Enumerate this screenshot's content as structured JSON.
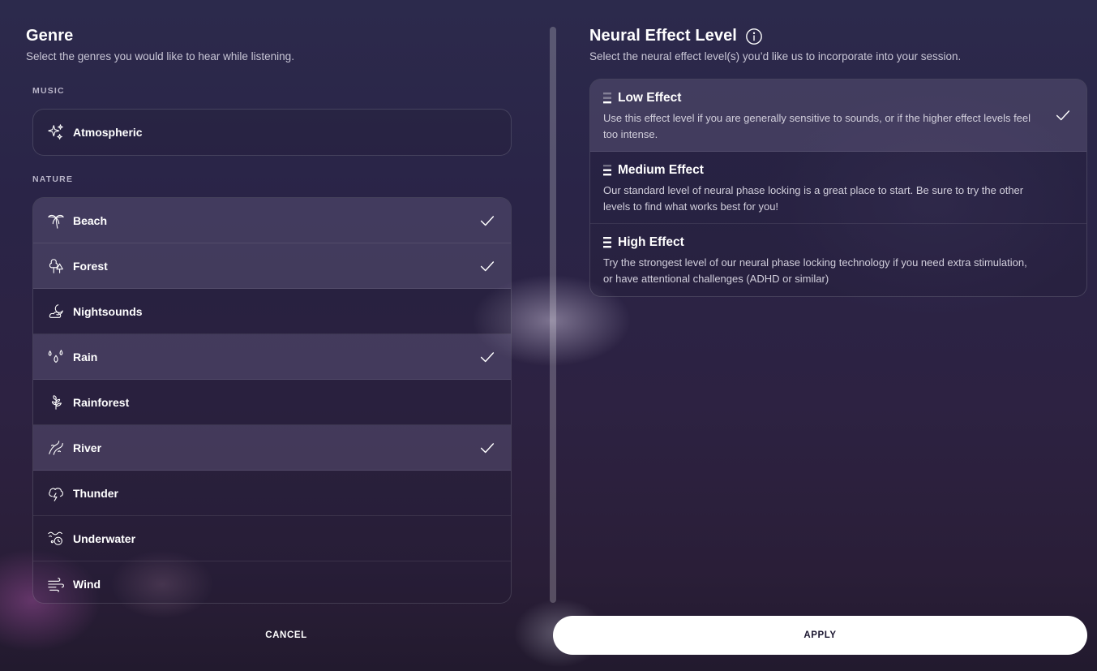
{
  "genre": {
    "title": "Genre",
    "subtitle": "Select the genres you would like to hear while listening.",
    "groups": [
      {
        "label": "MUSIC",
        "items": [
          {
            "label": "Atmospheric",
            "icon": "sparkles-icon",
            "selected": false
          }
        ]
      },
      {
        "label": "NATURE",
        "items": [
          {
            "label": "Beach",
            "icon": "palm-tree-icon",
            "selected": true
          },
          {
            "label": "Forest",
            "icon": "trees-icon",
            "selected": true
          },
          {
            "label": "Nightsounds",
            "icon": "moon-cloud-icon",
            "selected": false
          },
          {
            "label": "Rain",
            "icon": "raindrops-icon",
            "selected": true
          },
          {
            "label": "Rainforest",
            "icon": "sprout-icon",
            "selected": false
          },
          {
            "label": "River",
            "icon": "river-icon",
            "selected": true
          },
          {
            "label": "Thunder",
            "icon": "thunder-cloud-icon",
            "selected": false
          },
          {
            "label": "Underwater",
            "icon": "underwater-icon",
            "selected": false
          },
          {
            "label": "Wind",
            "icon": "wind-icon",
            "selected": false
          }
        ]
      }
    ]
  },
  "neural": {
    "title": "Neural Effect Level",
    "subtitle": "Select the neural effect level(s) you’d like us to incorporate into your session.",
    "levels": [
      {
        "label": "Low Effect",
        "description": "Use this effect level if you are generally sensitive to sounds, or if the higher effect levels feel too intense.",
        "bars_filled": 1,
        "selected": true
      },
      {
        "label": "Medium Effect",
        "description": "Our standard level of neural phase locking is a great place to start. Be sure to try the other levels to find what works best for you!",
        "bars_filled": 2,
        "selected": false
      },
      {
        "label": "High Effect",
        "description": "Try the strongest level of our neural phase locking technology if you need extra stimulation, or have attentional challenges (ADHD or similar)",
        "bars_filled": 3,
        "selected": false
      }
    ]
  },
  "footer": {
    "cancel_label": "CANCEL",
    "apply_label": "APPLY"
  },
  "colors": {
    "accent": "#ffffff",
    "selected_row": "#4a4266",
    "background": "#2a2447"
  }
}
